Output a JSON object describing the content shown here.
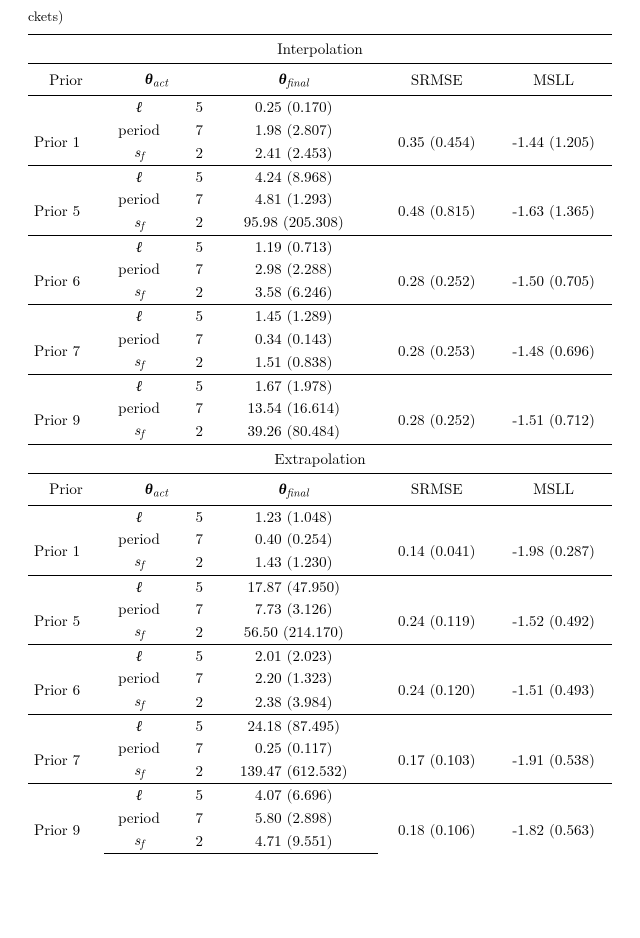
{
  "header_fragment": "ckets)",
  "columns": {
    "prior": "Prior",
    "theta_act": "θ",
    "theta_act_sub": "act",
    "theta_final": "θ",
    "theta_final_sub": "final",
    "srmse": "SRMSE",
    "msll": "MSLL"
  },
  "params": {
    "ell": "ℓ",
    "period": "period",
    "sf": "s",
    "sf_sub": "f"
  },
  "act_values": {
    "ell": "5",
    "period": "7",
    "sf": "2"
  },
  "sections": [
    {
      "title": "Interpolation",
      "rows": [
        {
          "prior": "Prior 1",
          "final": {
            "ell": "0.25 (0.170)",
            "period": "1.98 (2.807)",
            "sf": "2.41 (2.453)"
          },
          "srmse": "0.35 (0.454)",
          "msll": "-1.44 (1.205)"
        },
        {
          "prior": "Prior 5",
          "final": {
            "ell": "4.24 (8.968)",
            "period": "4.81 (1.293)",
            "sf": "95.98 (205.308)"
          },
          "srmse": "0.48 (0.815)",
          "msll": "-1.63 (1.365)"
        },
        {
          "prior": "Prior 6",
          "final": {
            "ell": "1.19 (0.713)",
            "period": "2.98 (2.288)",
            "sf": "3.58 (6.246)"
          },
          "srmse": "0.28 (0.252)",
          "msll": "-1.50 (0.705)"
        },
        {
          "prior": "Prior 7",
          "final": {
            "ell": "1.45 (1.289)",
            "period": "0.34 (0.143)",
            "sf": "1.51 (0.838)"
          },
          "srmse": "0.28 (0.253)",
          "msll": "-1.48 (0.696)"
        },
        {
          "prior": "Prior 9",
          "final": {
            "ell": "1.67 (1.978)",
            "period": "13.54 (16.614)",
            "sf": "39.26 (80.484)"
          },
          "srmse": "0.28 (0.252)",
          "msll": "-1.51 (0.712)"
        }
      ]
    },
    {
      "title": "Extrapolation",
      "rows": [
        {
          "prior": "Prior 1",
          "final": {
            "ell": "1.23 (1.048)",
            "period": "0.40 (0.254)",
            "sf": "1.43 (1.230)"
          },
          "srmse": "0.14 (0.041)",
          "msll": "-1.98 (0.287)"
        },
        {
          "prior": "Prior 5",
          "final": {
            "ell": "17.87 (47.950)",
            "period": "7.73 (3.126)",
            "sf": "56.50 (214.170)"
          },
          "srmse": "0.24 (0.119)",
          "msll": "-1.52 (0.492)"
        },
        {
          "prior": "Prior 6",
          "final": {
            "ell": "2.01 (2.023)",
            "period": "2.20 (1.323)",
            "sf": "2.38 (3.984)"
          },
          "srmse": "0.24 (0.120)",
          "msll": "-1.51 (0.493)"
        },
        {
          "prior": "Prior 7",
          "final": {
            "ell": "24.18 (87.495)",
            "period": "0.25 (0.117)",
            "sf": "139.47 (612.532)"
          },
          "srmse": "0.17 (0.103)",
          "msll": "-1.91 (0.538)"
        },
        {
          "prior": "Prior 9",
          "final": {
            "ell": "4.07 (6.696)",
            "period": "5.80 (2.898)",
            "sf": "4.71 (9.551)"
          },
          "srmse": "0.18 (0.106)",
          "msll": "-1.82 (0.563)"
        }
      ]
    }
  ]
}
